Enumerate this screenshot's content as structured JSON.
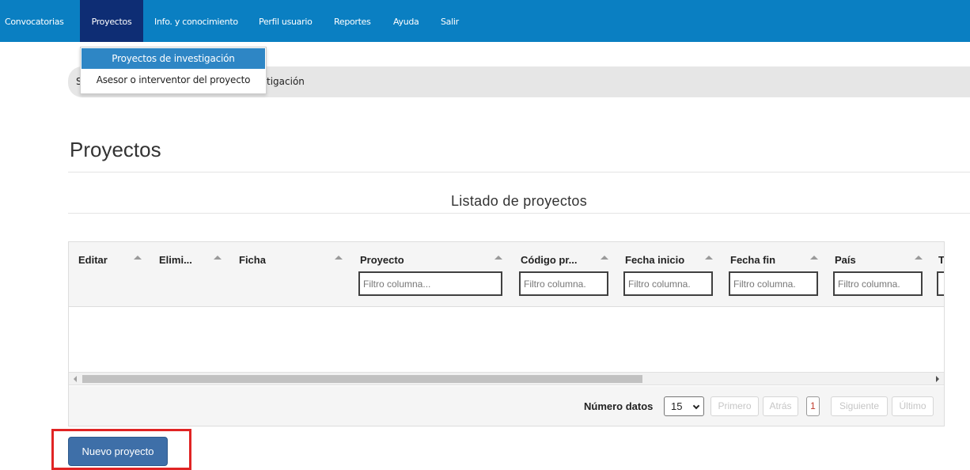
{
  "nav": {
    "items": [
      {
        "label": "Convocatorias"
      },
      {
        "label": "Proyectos"
      },
      {
        "label": "Info. y conocimiento"
      },
      {
        "label": "Perfil usuario"
      },
      {
        "label": "Reportes"
      },
      {
        "label": "Ayuda"
      },
      {
        "label": "Salir"
      }
    ],
    "active": "Proyectos"
  },
  "dropdown": {
    "items": [
      {
        "label": "Proyectos de investigación"
      },
      {
        "label": "Asesor o interventor del proyecto"
      }
    ]
  },
  "breadcrumb": {
    "visible_start": "S",
    "visible_end": "tigación"
  },
  "page": {
    "title": "Proyectos",
    "subtitle": "Listado de proyectos"
  },
  "grid": {
    "columns": [
      {
        "label": "Editar"
      },
      {
        "label": "Elimi..."
      },
      {
        "label": "Ficha"
      },
      {
        "label": "Proyecto",
        "filter_placeholder": "Filtro columna..."
      },
      {
        "label": "Código pr...",
        "filter_placeholder": "Filtro columna."
      },
      {
        "label": "Fecha inicio",
        "filter_placeholder": "Filtro columna."
      },
      {
        "label": "Fecha fin",
        "filter_placeholder": "Filtro columna."
      },
      {
        "label": "País",
        "filter_placeholder": "Filtro columna."
      },
      {
        "label": "T"
      }
    ],
    "pager": {
      "label": "Número datos",
      "page_size": "15",
      "first": "Primero",
      "prev": "Atrás",
      "current_page": "1",
      "next": "Siguiente",
      "last": "Último"
    }
  },
  "actions": {
    "new_project": "Nuevo proyecto"
  },
  "colors": {
    "nav_bg": "#0a7fc2",
    "nav_active_bg": "#0e2d74",
    "dropdown_highlight": "#2e86c5",
    "primary_button": "#3e6fa8",
    "highlight_box": "#e02424"
  }
}
